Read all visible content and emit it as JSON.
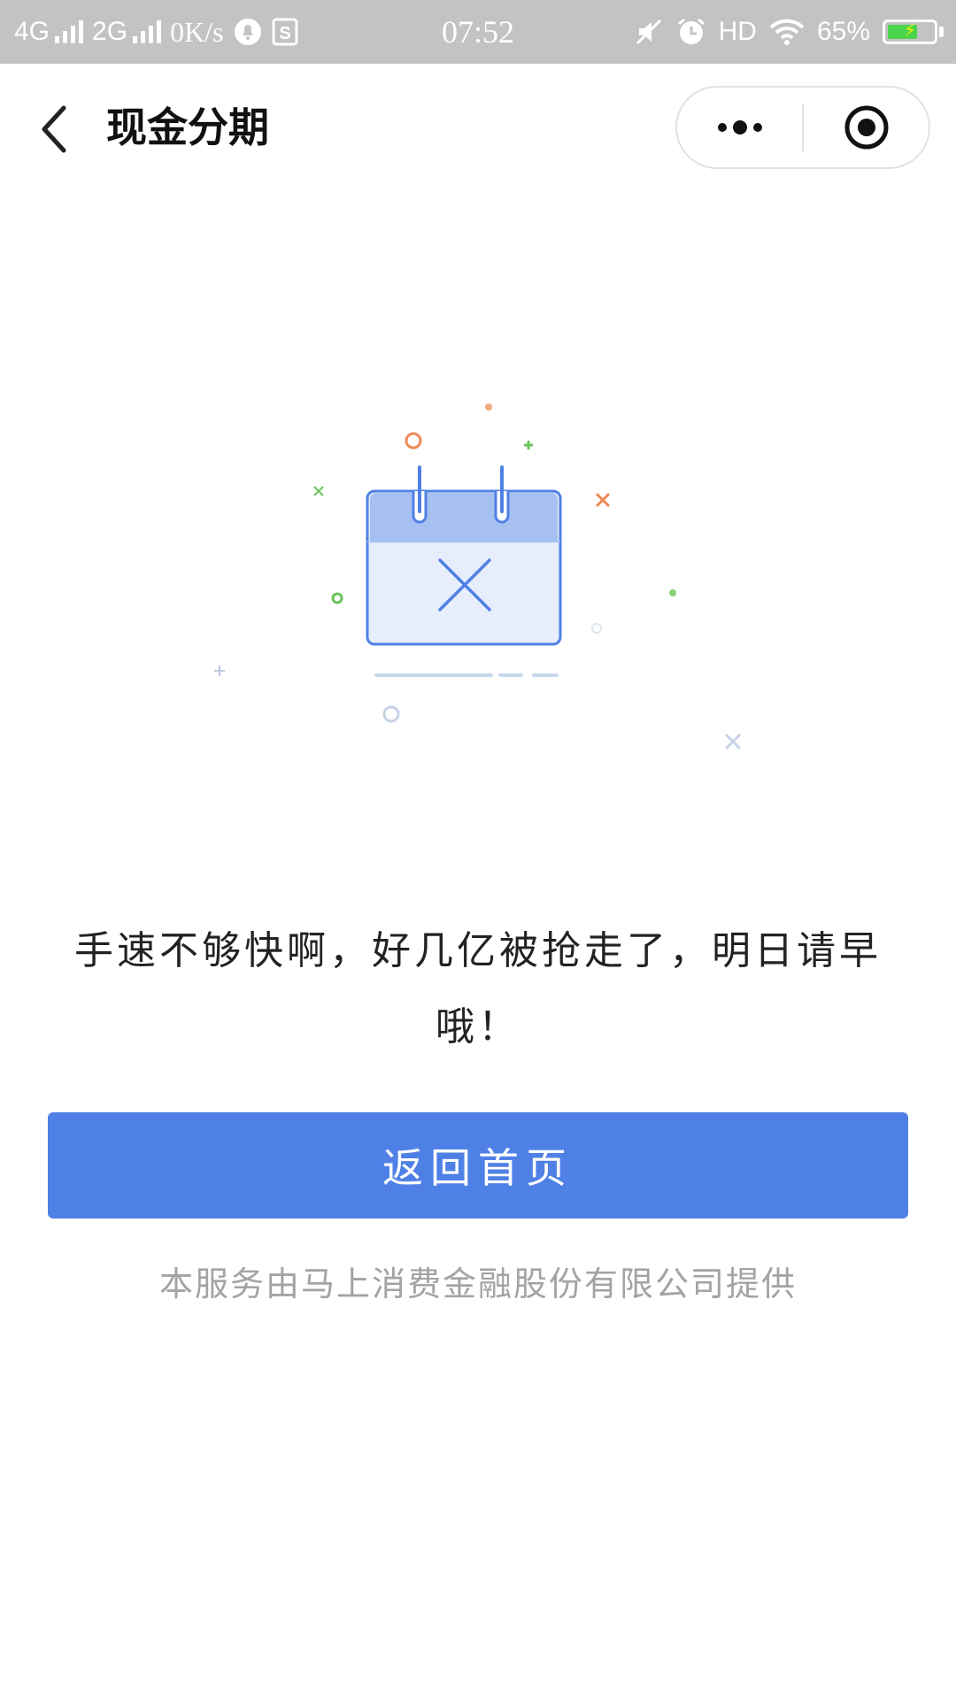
{
  "status_bar": {
    "network_1": "4G",
    "network_2": "2G",
    "speed": "0K/s",
    "time": "07:52",
    "hd_label": "HD",
    "battery_text": "65%",
    "battery_level": 0.65,
    "icons": [
      "signal-bars-icon",
      "notification-bell-icon",
      "app-s-icon",
      "mute-icon",
      "alarm-clock-icon",
      "wifi-icon",
      "battery-charging-icon"
    ]
  },
  "nav": {
    "title": "现金分期",
    "icons": [
      "back-arrow-icon",
      "more-dots-icon",
      "close-target-icon"
    ]
  },
  "main": {
    "message": "手速不够快啊，好几亿被抢走了，明日请早哦！",
    "home_button_label": "返回首页",
    "provider_note": "本服务由马上消费金融股份有限公司提供"
  },
  "colors": {
    "status_bar_bg": "#c3c3c3",
    "accent_blue": "#4f80e6",
    "calendar_header": "#a6c0f2",
    "calendar_body": "#e6eefb",
    "note_gray": "#a3a3a3",
    "decor_orange": "#ef8a55",
    "decor_green": "#6cc35b"
  }
}
